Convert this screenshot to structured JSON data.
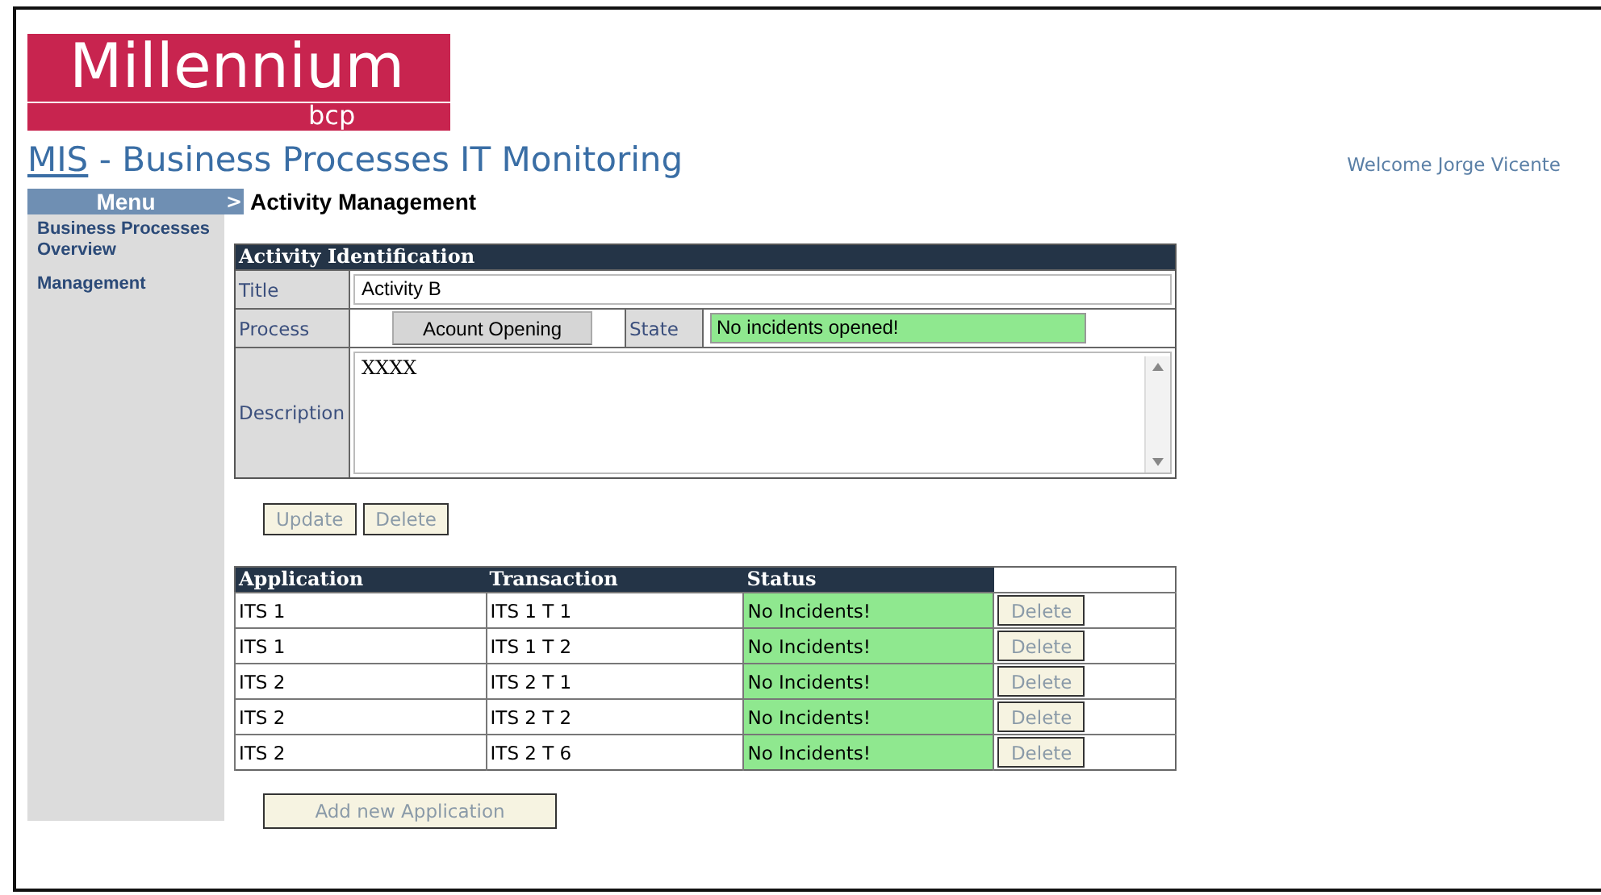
{
  "logo": {
    "name": "Millennium",
    "sub": "bcp"
  },
  "header": {
    "link": "MIS",
    "title": " - Business Processes IT Monitoring",
    "welcome": "Welcome Jorge Vicente"
  },
  "menu": {
    "title": "Menu",
    "items": [
      "Business Processes Overview",
      "Management"
    ]
  },
  "breadcrumb": {
    "marker": ">",
    "title": "Activity Management"
  },
  "activity": {
    "heading": "Activity Identification",
    "title_label": "Title",
    "title_value": "Activity B",
    "process_label": "Process",
    "process_button": "Acount Opening",
    "state_label": "State",
    "state_value": "No incidents opened!",
    "description_label": "Description",
    "description_value": "XXXX"
  },
  "actions": [
    "Update",
    "Delete"
  ],
  "applications": {
    "columns": [
      "Application",
      "Transaction",
      "Status"
    ],
    "rows": [
      {
        "application": "ITS 1",
        "transaction": "ITS 1 T 1",
        "status": "No Incidents!",
        "action": "Delete"
      },
      {
        "application": "ITS 1",
        "transaction": "ITS 1 T 2",
        "status": "No Incidents!",
        "action": "Delete"
      },
      {
        "application": "ITS 2",
        "transaction": "ITS 2 T 1",
        "status": "No Incidents!",
        "action": "Delete"
      },
      {
        "application": "ITS 2",
        "transaction": "ITS 2 T 2",
        "status": "No Incidents!",
        "action": "Delete"
      },
      {
        "application": "ITS 2",
        "transaction": "ITS 2 T 6",
        "status": "No Incidents!",
        "action": "Delete"
      }
    ],
    "add_button": "Add new Application"
  }
}
